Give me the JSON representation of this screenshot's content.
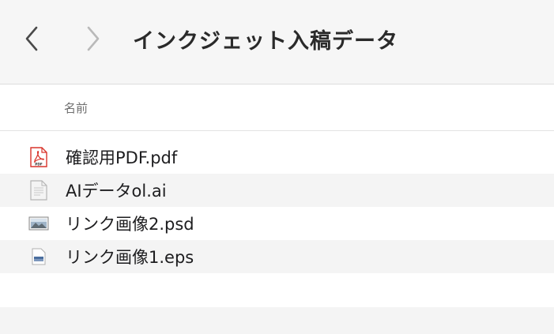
{
  "window": {
    "title": "インクジェット入稿データ"
  },
  "toolbar": {
    "back_icon": "chevron-left-icon",
    "forward_icon": "chevron-right-icon"
  },
  "columns": {
    "name": "名前"
  },
  "files": [
    {
      "name": "確認用PDF.pdf",
      "icon": "pdf-file-icon"
    },
    {
      "name": "AIデータol.ai",
      "icon": "ai-file-icon"
    },
    {
      "name": "リンク画像2.psd",
      "icon": "image-file-icon"
    },
    {
      "name": "リンク画像1.eps",
      "icon": "eps-file-icon"
    }
  ],
  "colors": {
    "pdf_red": "#d9342b",
    "toolbar_bg": "#f6f6f6",
    "alt_row": "#f4f4f4"
  }
}
